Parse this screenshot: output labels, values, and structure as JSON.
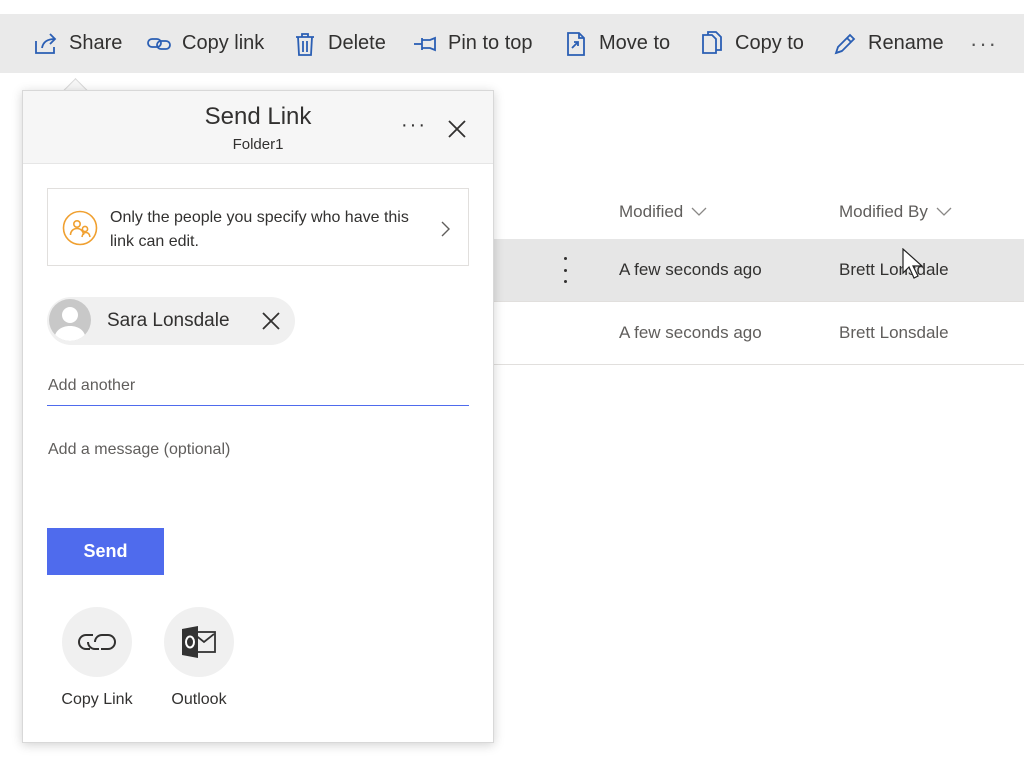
{
  "command_bar": {
    "share": "Share",
    "copy_link": "Copy link",
    "delete": "Delete",
    "pin_to_top": "Pin to top",
    "move_to": "Move to",
    "copy_to": "Copy to",
    "rename": "Rename",
    "more": "···"
  },
  "file_list": {
    "columns": {
      "modified": "Modified",
      "modified_by": "Modified By"
    },
    "rows": [
      {
        "modified": "A few seconds ago",
        "modified_by": "Brett Lonsdale",
        "selected": true
      },
      {
        "modified": "A few seconds ago",
        "modified_by": "Brett Lonsdale",
        "selected": false
      }
    ]
  },
  "share_panel": {
    "title": "Send Link",
    "subtitle": "Folder1",
    "more": "···",
    "permission_text": "Only the people you specify who have this link can edit.",
    "recipient": {
      "name": "Sara Lonsdale"
    },
    "add_placeholder": "Add another",
    "message_placeholder": "Add a message (optional)",
    "send_label": "Send",
    "options": [
      {
        "label": "Copy Link",
        "icon": "link-icon"
      },
      {
        "label": "Outlook",
        "icon": "outlook-icon"
      }
    ]
  },
  "colors": {
    "accent": "#4f6bed",
    "permission_icon": "#f0a030",
    "command_bar_bg": "#eaeaea",
    "selected_row_bg": "#e6e6e6"
  }
}
